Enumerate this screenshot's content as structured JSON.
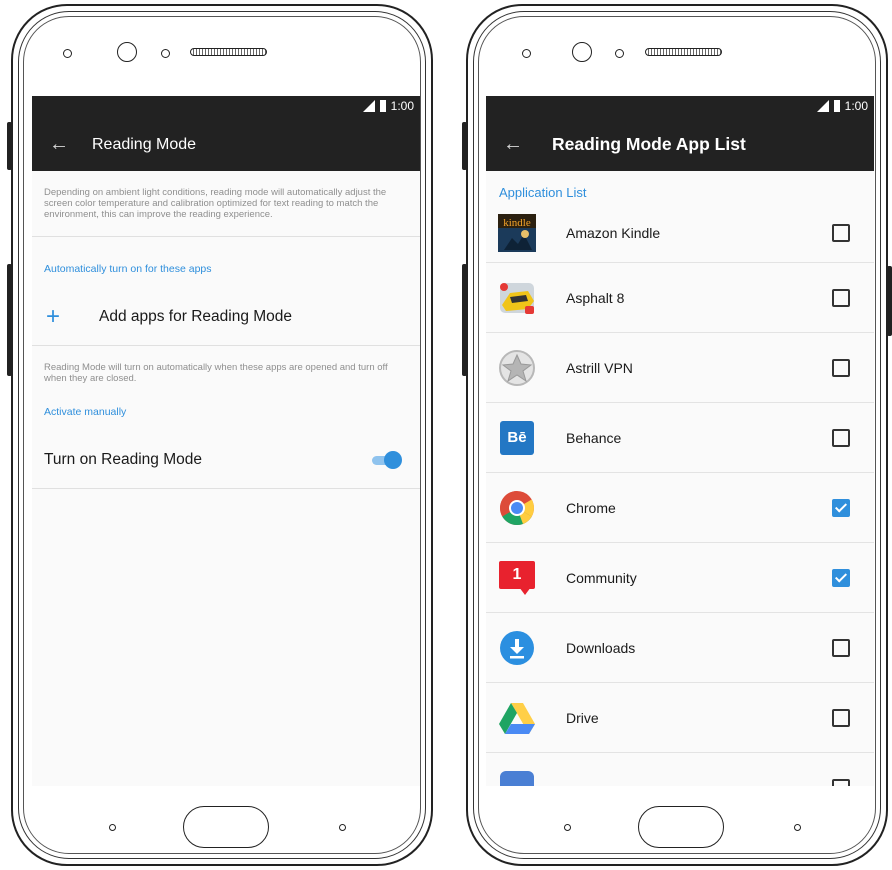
{
  "left": {
    "status": {
      "time": "1:00"
    },
    "appbar": {
      "title": "Reading Mode"
    },
    "description": "Depending on ambient light conditions, reading mode will automatically adjust the screen color temperature and calibration optimized for text reading to match the environment, this can improve the reading experience.",
    "auto_section": {
      "title": "Automatically turn on for these apps",
      "add_label": "Add apps for Reading Mode"
    },
    "auto_note": "Reading Mode will turn on automatically when these apps are opened and turn off when they are closed.",
    "manual_section": {
      "title": "Activate manually",
      "toggle_label": "Turn on Reading Mode",
      "toggle_on": true
    }
  },
  "right": {
    "status": {
      "time": "1:00"
    },
    "appbar": {
      "title": "Reading Mode App List"
    },
    "list_header": "Application List",
    "apps": [
      {
        "name": "Amazon Kindle",
        "icon": "kindle-icon",
        "checked": false
      },
      {
        "name": "Asphalt 8",
        "icon": "asphalt-icon",
        "checked": false
      },
      {
        "name": "Astrill VPN",
        "icon": "astrill-star-icon",
        "checked": false
      },
      {
        "name": "Behance",
        "icon": "behance-icon",
        "icon_text": "Bē",
        "checked": false
      },
      {
        "name": "Chrome",
        "icon": "chrome-icon",
        "checked": true
      },
      {
        "name": "Community",
        "icon": "community-icon",
        "icon_text": "1",
        "checked": true
      },
      {
        "name": "Downloads",
        "icon": "download-icon",
        "checked": false
      },
      {
        "name": "Drive",
        "icon": "drive-icon",
        "checked": false
      },
      {
        "name": "",
        "icon": "partial-app-icon",
        "checked": false
      }
    ]
  },
  "colors": {
    "accent": "#2f8fdc",
    "appbar": "#222222",
    "checked": "#2f8fdc"
  }
}
